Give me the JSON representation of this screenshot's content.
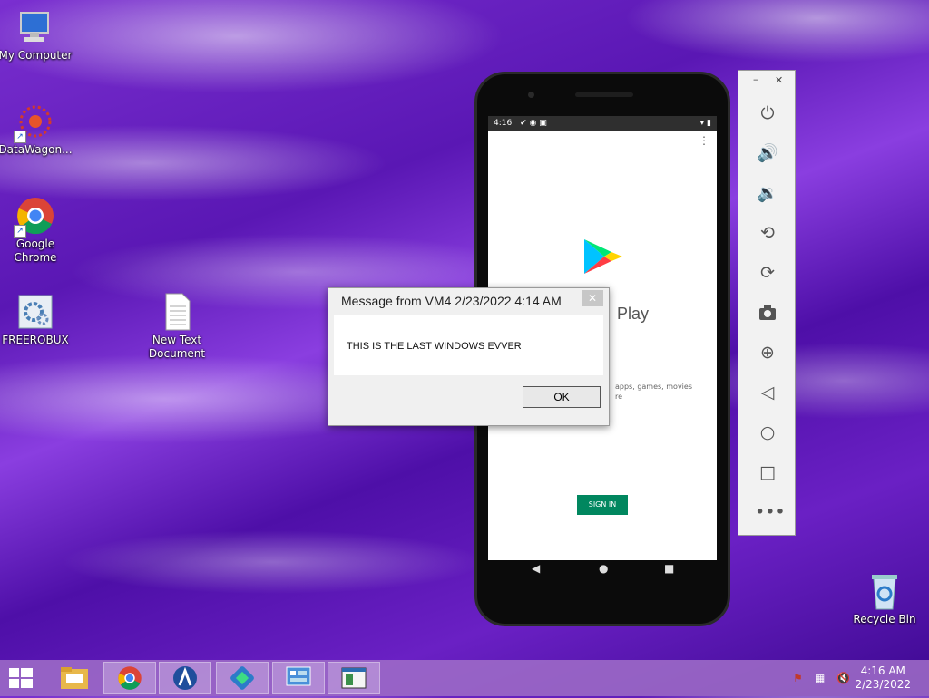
{
  "desktop": {
    "icons": [
      {
        "label": "My Computer"
      },
      {
        "label": "DataWagon..."
      },
      {
        "label": "Google Chrome"
      },
      {
        "label": "FREEROBUX"
      },
      {
        "label": "New Text Document"
      },
      {
        "label": "Recycle Bin"
      }
    ]
  },
  "phone": {
    "status_time": "4:16",
    "app_title": "Play",
    "description": "apps, games, movies",
    "description2": "re",
    "sign_in": "SIGN IN",
    "brand_color": "#01875f"
  },
  "emulator_toolbar": {
    "buttons": [
      "power-icon",
      "volume-up-icon",
      "volume-down-icon",
      "rotate-left-icon",
      "rotate-right-icon",
      "camera-icon",
      "zoom-icon",
      "back-icon",
      "home-icon",
      "overview-icon",
      "more-icon"
    ]
  },
  "dialog": {
    "title": "Message from VM4 2/23/2022 4:14 AM",
    "message": "THIS IS THE LAST WINDOWS EVVER",
    "ok_label": "OK",
    "close_glyph": "✕"
  },
  "taskbar": {
    "time": "4:16 AM",
    "date": "2/23/2022"
  }
}
